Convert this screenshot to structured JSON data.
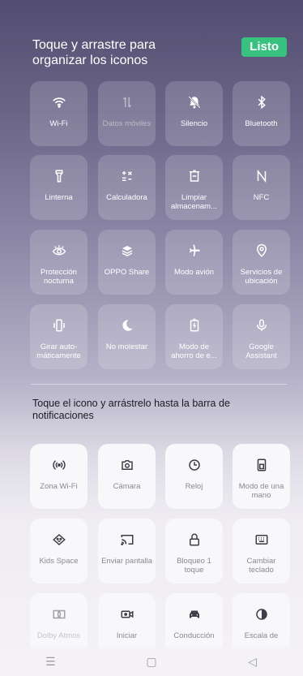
{
  "header": {
    "title": "Toque y arrastre para organizar los iconos",
    "done_label": "Listo"
  },
  "active_tiles": [
    {
      "label": "Wi-Fi",
      "icon": "wifi-icon"
    },
    {
      "label": "Datos móviles",
      "icon": "mobile-data-icon"
    },
    {
      "label": "Silencio",
      "icon": "bell-off-icon"
    },
    {
      "label": "Bluetooth",
      "icon": "bluetooth-icon"
    },
    {
      "label": "Linterna",
      "icon": "flashlight-icon"
    },
    {
      "label": "Calculadora",
      "icon": "calculator-icon"
    },
    {
      "label": "Limpiar almacenam...",
      "icon": "clean-storage-icon"
    },
    {
      "label": "NFC",
      "icon": "nfc-icon"
    },
    {
      "label": "Protección nocturna",
      "icon": "eye-comfort-icon"
    },
    {
      "label": "OPPO Share",
      "icon": "oppo-share-icon"
    },
    {
      "label": "Modo avión",
      "icon": "airplane-icon"
    },
    {
      "label": "Servicios de ubicación",
      "icon": "location-icon"
    },
    {
      "label": "Girar auto-máticamente",
      "icon": "auto-rotate-icon"
    },
    {
      "label": "No molestar",
      "icon": "moon-icon"
    },
    {
      "label": "Modo de ahorro de e...",
      "icon": "battery-saver-icon"
    },
    {
      "label": "Google Assistant",
      "icon": "microphone-icon"
    }
  ],
  "section": {
    "title": "Toque el icono y arrástrelo hasta la barra de notificaciones"
  },
  "available_tiles": [
    {
      "label": "Zona Wi-Fi",
      "icon": "hotspot-icon"
    },
    {
      "label": "Cámara",
      "icon": "camera-icon"
    },
    {
      "label": "Reloj",
      "icon": "clock-icon"
    },
    {
      "label": "Modo de una mano",
      "icon": "one-hand-icon"
    },
    {
      "label": "Kids Space",
      "icon": "kids-space-icon"
    },
    {
      "label": "Enviar pantalla",
      "icon": "cast-icon"
    },
    {
      "label": "Bloqueo 1 toque",
      "icon": "lock-icon"
    },
    {
      "label": "Cambiar teclado",
      "icon": "keyboard-icon"
    },
    {
      "label": "Dolby Atmos",
      "icon": "dolby-icon"
    },
    {
      "label": "Iniciar",
      "icon": "screen-record-icon"
    },
    {
      "label": "Conducción",
      "icon": "car-icon"
    },
    {
      "label": "Escala de",
      "icon": "grayscale-icon"
    }
  ],
  "navbar": {
    "menu_glyph": "☰",
    "home_glyph": "▢",
    "back_glyph": "◁"
  }
}
